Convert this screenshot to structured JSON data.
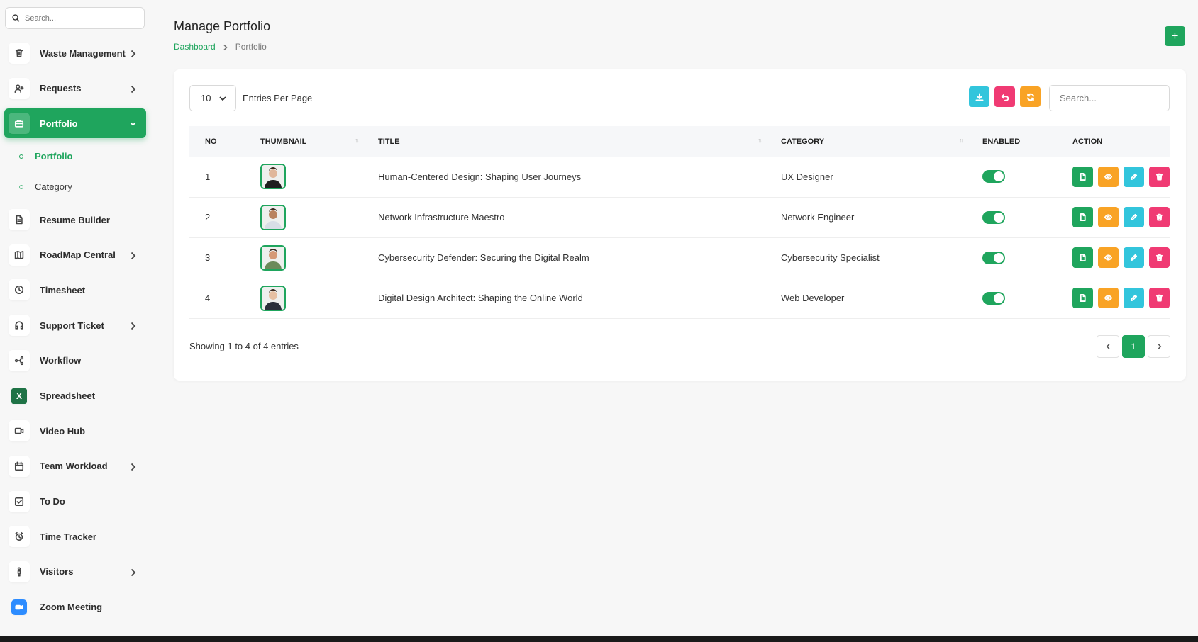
{
  "sidebar": {
    "search_placeholder": "Search...",
    "items": [
      {
        "label": "Waste Management",
        "icon": "trash-icon",
        "chevron": true
      },
      {
        "label": "Requests",
        "icon": "user-plus-icon",
        "chevron": true
      },
      {
        "label": "Portfolio",
        "icon": "briefcase-icon",
        "chevron": true,
        "active": true
      },
      {
        "label": "Resume Builder",
        "icon": "document-icon",
        "chevron": false
      },
      {
        "label": "RoadMap Central",
        "icon": "map-icon",
        "chevron": true
      },
      {
        "label": "Timesheet",
        "icon": "clock-icon",
        "chevron": false
      },
      {
        "label": "Support Ticket",
        "icon": "headset-icon",
        "chevron": true
      },
      {
        "label": "Workflow",
        "icon": "share-icon",
        "chevron": false
      },
      {
        "label": "Spreadsheet",
        "icon": "excel-icon",
        "chevron": false
      },
      {
        "label": "Video Hub",
        "icon": "video-icon",
        "chevron": false
      },
      {
        "label": "Team Workload",
        "icon": "calendar-icon",
        "chevron": true
      },
      {
        "label": "To Do",
        "icon": "checkbox-icon",
        "chevron": false
      },
      {
        "label": "Time Tracker",
        "icon": "alarm-icon",
        "chevron": false
      },
      {
        "label": "Visitors",
        "icon": "person-icon",
        "chevron": true
      },
      {
        "label": "Zoom Meeting",
        "icon": "zoom-icon",
        "chevron": false
      }
    ],
    "sub_items": [
      {
        "label": "Portfolio",
        "active": true
      },
      {
        "label": "Category",
        "active": false
      }
    ]
  },
  "header": {
    "title": "Manage Portfolio",
    "breadcrumb_home": "Dashboard",
    "breadcrumb_current": "Portfolio",
    "add_label": "+"
  },
  "toolbar": {
    "per_page_value": "10",
    "per_page_label": "Entries Per Page",
    "search_placeholder": "Search..."
  },
  "table": {
    "columns": [
      "NO",
      "THUMBNAIL",
      "TITLE",
      "CATEGORY",
      "ENABLED",
      "ACTION"
    ],
    "rows": [
      {
        "no": "1",
        "title": "Human-Centered Design: Shaping User Journeys",
        "category": "UX Designer",
        "enabled": true
      },
      {
        "no": "2",
        "title": "Network Infrastructure Maestro",
        "category": "Network Engineer",
        "enabled": true
      },
      {
        "no": "3",
        "title": "Cybersecurity Defender: Securing the Digital Realm",
        "category": "Cybersecurity Specialist",
        "enabled": true
      },
      {
        "no": "4",
        "title": "Digital Design Architect: Shaping the Online World",
        "category": "Web Developer",
        "enabled": true
      }
    ]
  },
  "footer": {
    "showing": "Showing 1 to 4 of 4 entries",
    "current_page": "1"
  },
  "colors": {
    "accent": "#1fa55d",
    "cyan": "#32c5dc",
    "pink": "#f03a73",
    "orange": "#f9a325"
  }
}
